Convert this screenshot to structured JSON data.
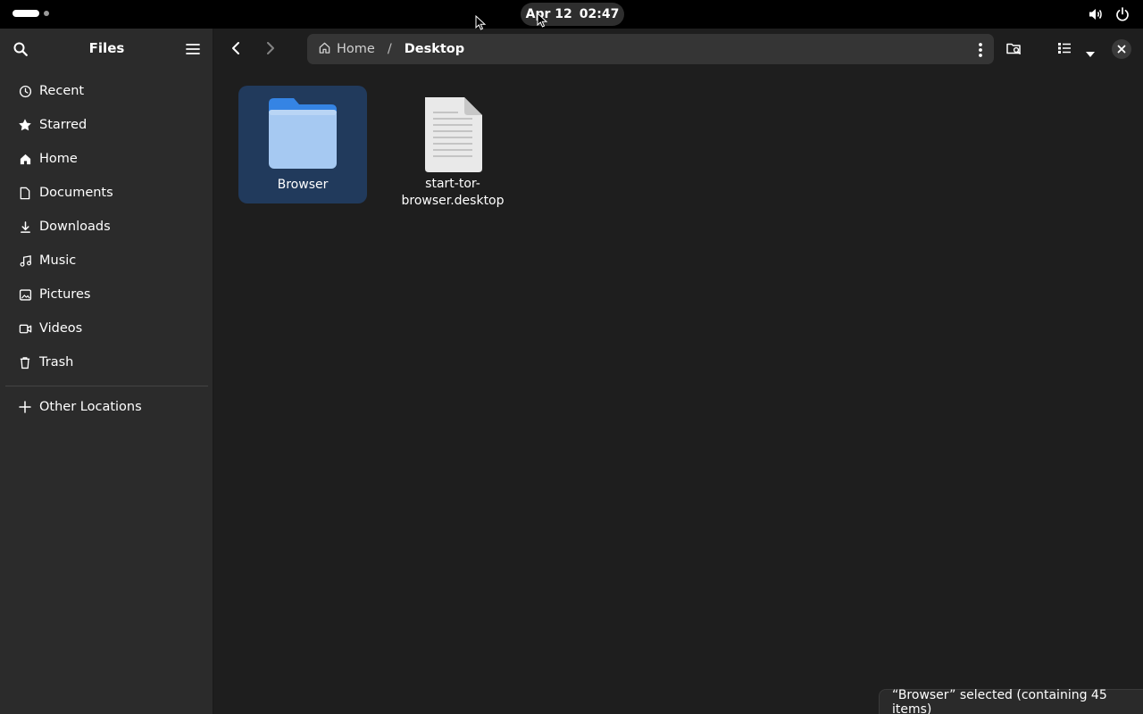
{
  "topbar": {
    "clock_date": "Apr 12",
    "clock_time": "02:47",
    "tray_icons": [
      "volume-icon",
      "power-icon"
    ]
  },
  "sidebar": {
    "title": "Files",
    "items": [
      {
        "label": "Recent",
        "icon": "clock-icon"
      },
      {
        "label": "Starred",
        "icon": "star-icon"
      },
      {
        "label": "Home",
        "icon": "home-icon"
      },
      {
        "label": "Documents",
        "icon": "document-icon"
      },
      {
        "label": "Downloads",
        "icon": "download-icon"
      },
      {
        "label": "Music",
        "icon": "music-icon"
      },
      {
        "label": "Pictures",
        "icon": "image-icon"
      },
      {
        "label": "Videos",
        "icon": "video-icon"
      },
      {
        "label": "Trash",
        "icon": "trash-icon"
      }
    ],
    "other_locations": "Other Locations"
  },
  "pathbar": {
    "home_label": "Home",
    "separator": "/",
    "current": "Desktop"
  },
  "files": [
    {
      "name": "Browser",
      "type": "folder",
      "selected": true
    },
    {
      "name": "start-tor-browser.desktop",
      "name_line1": "start-tor-",
      "name_line2": "browser.desktop",
      "type": "text-file",
      "selected": false
    }
  ],
  "status": {
    "text": "“Browser” selected  (containing 45 items)"
  },
  "colors": {
    "window_bg": "#1e1e1e",
    "sidebar_bg": "#2b2b2b",
    "selection": "#213a5c",
    "folder_blue": "#3584e4"
  }
}
